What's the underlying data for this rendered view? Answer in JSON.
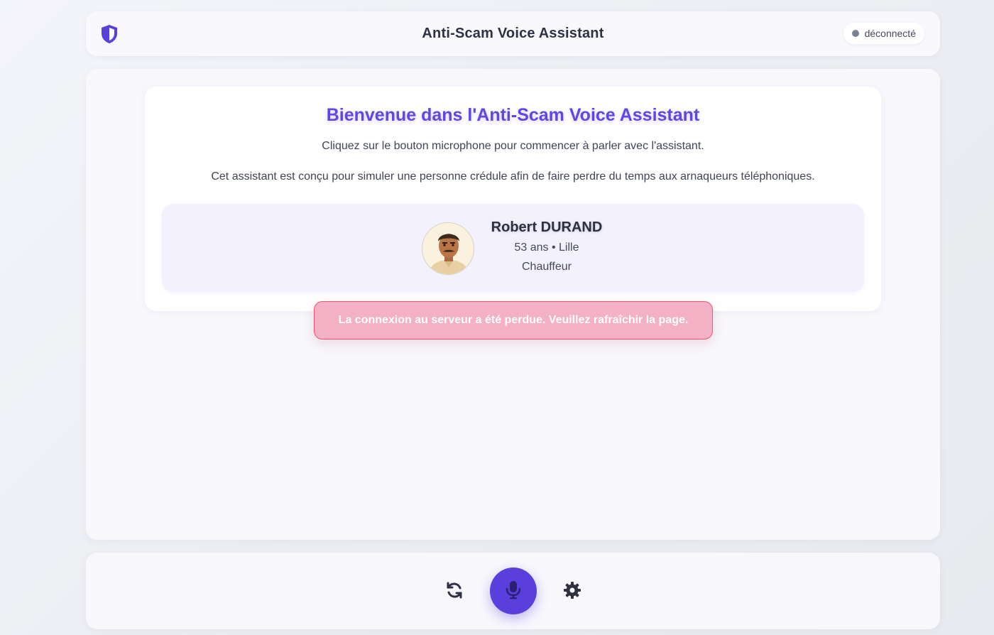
{
  "header": {
    "title": "Anti-Scam Voice Assistant",
    "status_label": "déconnecté",
    "logo_icon": "shield-icon"
  },
  "welcome": {
    "title": "Bienvenue dans l'Anti-Scam Voice Assistant",
    "line1": "Cliquez sur le bouton microphone pour commencer à parler avec l'assistant.",
    "line2": "Cet assistant est conçu pour simuler une personne crédule afin de faire perdre du temps aux arnaqueurs téléphoniques."
  },
  "persona": {
    "name": "Robert DURAND",
    "meta": "53 ans • Lille",
    "job": "Chauffeur"
  },
  "error": {
    "message": "La connexion au serveur a été perdue. Veuillez rafraîchir la page."
  },
  "controls": {
    "refresh_icon": "refresh-icon",
    "mic_icon": "microphone-icon",
    "settings_icon": "gear-icon"
  },
  "colors": {
    "accent": "#5b3fdc",
    "title": "#6246e0",
    "error_bg": "#f4b0c4",
    "error_border": "#e8576f",
    "status_dot": "#7a8194"
  }
}
